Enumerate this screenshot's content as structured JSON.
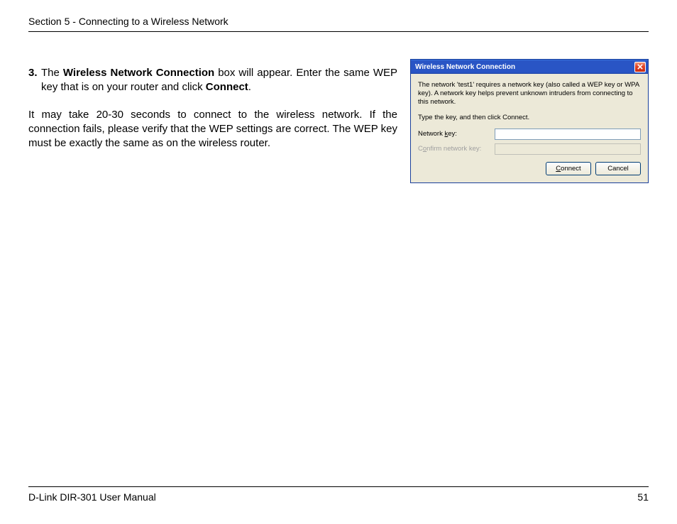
{
  "header": {
    "section_title": "Section 5 - Connecting to a Wireless Network"
  },
  "body": {
    "step_number": "3.",
    "step_line1_pre": "The ",
    "step_line1_bold1": "Wireless Network Connection",
    "step_line1_mid": " box will appear. Enter the same WEP key that is on your router and click ",
    "step_line1_bold2": "Connect",
    "step_line1_end": ".",
    "para2": "It may take 20-30 seconds to connect to the wireless network. If the connection fails, please verify that the WEP settings are correct. The WEP key must be exactly the same as on the wireless router."
  },
  "dialog": {
    "title": "Wireless Network Connection",
    "close_icon": "close-icon",
    "text1": "The network 'test1' requires a network key (also called a WEP key or WPA key). A network key helps prevent unknown intruders from connecting to this network.",
    "text2": "Type the key, and then click Connect.",
    "network_key_label": "Network key:",
    "confirm_key_label": "Confirm network key:",
    "network_key_value": "",
    "confirm_key_value": "",
    "connect_label": "Connect",
    "cancel_label": "Cancel"
  },
  "footer": {
    "manual_title": "D-Link DIR-301 User Manual",
    "page_number": "51"
  }
}
